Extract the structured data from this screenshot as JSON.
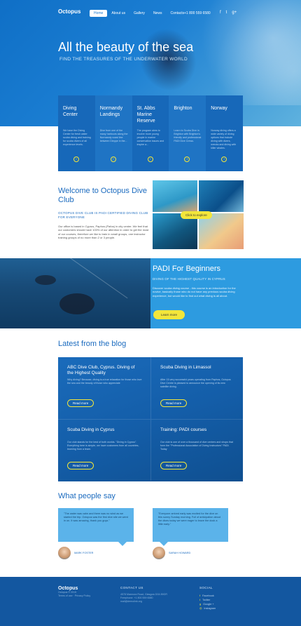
{
  "header": {
    "logo": "Octopus",
    "nav": [
      "Home",
      "About us",
      "Gallery",
      "News",
      "Contacts"
    ],
    "phone": "+1 800 559 6580",
    "social_icons": [
      "facebook-icon",
      "twitter-icon",
      "google-plus-icon"
    ]
  },
  "hero": {
    "title": "All the beauty of the sea",
    "subtitle": "FIND THE TREASURES OF THE UNDERWATER WORLD"
  },
  "cards": [
    {
      "title": "Diving Center",
      "desc": "We have the Diving Center for fresh water scuba diving and training for scuba divers of all experience levels."
    },
    {
      "title": "Normandy Landings",
      "desc": "Dive from one of the many harbours along the Normandy coast line between Dieppe in the..."
    },
    {
      "title": "St. Abbs Marine Reserve",
      "desc": "The program aims to involve more young people in marine conservation issues and inspire a..."
    },
    {
      "title": "Brighton",
      "desc": "Learn to Scuba Dive in Brighton with Brighton's friendly and professional PADI Dive Crews."
    },
    {
      "title": "Norway",
      "desc": "Norway diving offers a wide variety of diving options that include diving with divers, wrecks and diving with killer whales."
    }
  ],
  "welcome": {
    "title": "Welcome to Octopus Dive Club",
    "subtitle": "OCTOPUS DIVE CLUB IS PADI CERTIFIED DIVING CLUB FOR EVERYONE",
    "body": "Our office is based in Cyprus, Paphos (Pafos) in city center. We feel that our customers should have 100% of our attention in order to get the most of our courses, therefore we like to train in small groups, one instructor training groups of no more than 2 or 3 people.",
    "explore_button": "Click to explore"
  },
  "padi": {
    "title": "PADI For Beginners",
    "subtitle": "DIVING OF THE HIGHEST QUALITY IN CYPRUS",
    "body": "Discover scuba diving course - this course is an introduction for the novice, basically those who do not have any previous scuba diving experience, but would like to find out what diving is all about.",
    "button": "Learn more"
  },
  "blog": {
    "heading": "Latest from the blog",
    "posts": [
      {
        "title": "ABC Dive Club, Cyprus. Diving of the Highest Quality",
        "desc": "Why diving? Because, diving is a true relaxation for those who love the sea and the beauty of those who appreciate",
        "button": "Read more"
      },
      {
        "title": "Scuba Diving in Limassol",
        "desc": "After 15 very successful years operating from Paphos, Octopus Dive Centre is pleased to announce the opening of its new satellite diving.",
        "button": "Read more"
      },
      {
        "title": "Scuba Diving in Cyprus",
        "desc": "Our club stands for the best of both worlds. \"Diving in Cyprus\". Everything here is simple, we have customers from all countries, learning from a team.",
        "button": "Read more"
      },
      {
        "title": "Training: PADI courses",
        "desc": "Our club is one of over a thousand of dive centers and shops that form the \"Professional Association of Diving Instructors\" PADI. Today",
        "button": "Read more"
      }
    ]
  },
  "testimonials": {
    "heading": "What people say",
    "items": [
      {
        "quote": "\"The water was calm and there was no wind as we started the trip. Octopus was the first dive site we went in on. It was amazing, thank you guys.\"",
        "author": "MARK FOSTER"
      },
      {
        "quote": "\"Everyone arrived early was excited for the dive on this sunny Sunday morning. Full of anticipation about the dives today we were eager to leave the dock a little early.\"",
        "author": "SARAH HOWARD"
      }
    ]
  },
  "footer": {
    "logo": "Octopus",
    "copyright": "Octopus © 2015",
    "links": "Terms of use · Privacy Policy",
    "contact_heading": "CONTACT US",
    "address": "4578 Marmora Road, Glasgow D04 89GR",
    "phone": "Freephone: +1 800 559 6580",
    "email": "mail@demolink.org",
    "social_heading": "SOCIAL",
    "social_links": [
      "Facebook",
      "Twitter",
      "Google +",
      "Instagram"
    ]
  },
  "colors": {
    "primary": "#1b6bbf",
    "accent": "#f3e63a",
    "footer": "#1357a0",
    "padi": "#2d9be0"
  }
}
